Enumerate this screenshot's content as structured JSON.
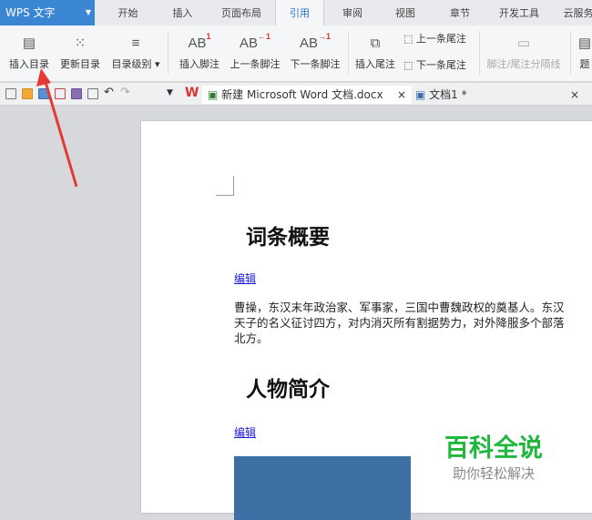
{
  "app": {
    "name": "WPS 文字"
  },
  "tabs": [
    "开始",
    "插入",
    "页面布局",
    "引用",
    "审阅",
    "视图",
    "章节",
    "开发工具",
    "云服务"
  ],
  "active_tab": "引用",
  "ribbon": {
    "insert_toc": "插入目录",
    "update_toc": "更新目录",
    "toc_level": "目录级别",
    "insert_footnote": "插入脚注",
    "prev_footnote": "上一条脚注",
    "next_footnote": "下一条脚注",
    "insert_endnote": "插入尾注",
    "prev_endnote": "上一条尾注",
    "next_endnote": "下一条尾注",
    "separator": "脚注/尾注分隔线",
    "more": "题"
  },
  "doc_tabs": [
    {
      "label": "新建 Microsoft Word 文档.docx"
    },
    {
      "label": "文档1 *"
    }
  ],
  "document": {
    "heading1": "词条概要",
    "edit1": "编辑",
    "para": [
      "曹操，东汉末年政治家、军事家，三国中曹魏政权的奠基人。东汉",
      "天子的名义征讨四方，对内消灭所有割据势力，对外降服多个部落",
      "北方。"
    ],
    "heading2": "人物简介",
    "edit2": "编辑"
  },
  "watermark": {
    "title": "百科全说",
    "subtitle": "助你轻松解决"
  },
  "colors": {
    "accent": "#3b86d3",
    "arrow": "#e53935",
    "watermark": "#1fb83d"
  }
}
